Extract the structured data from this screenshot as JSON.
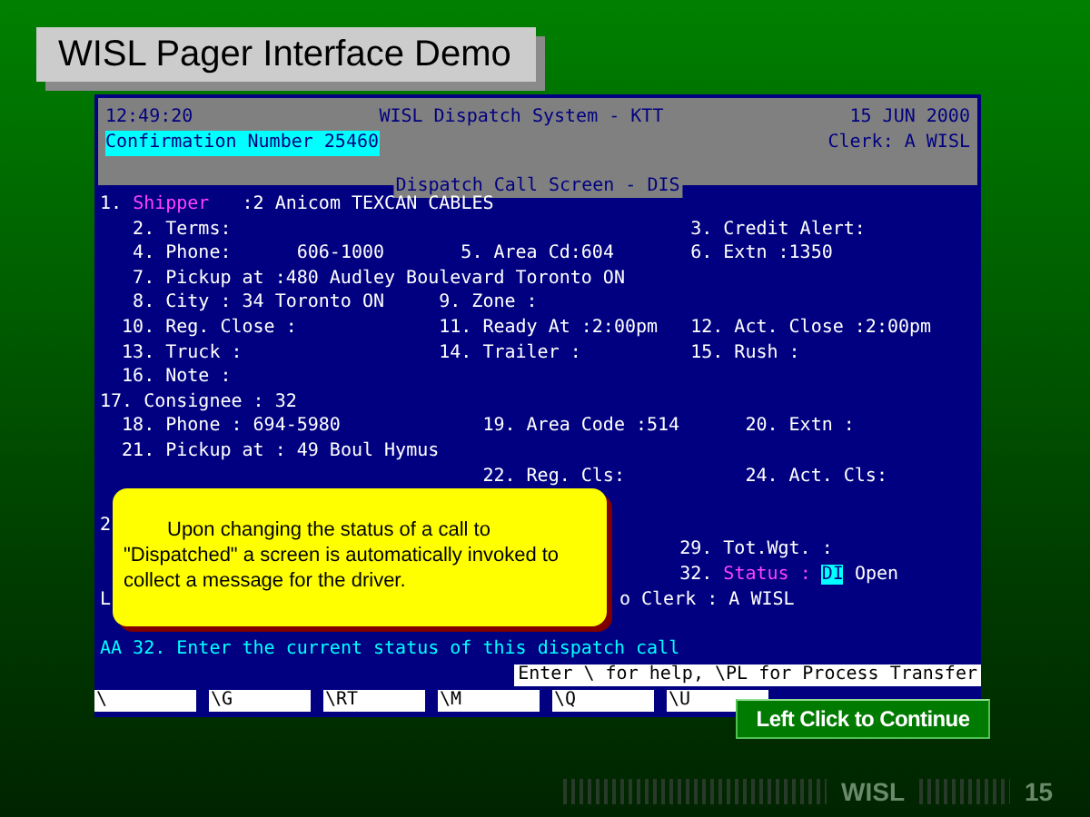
{
  "slide": {
    "title": "WISL Pager Interface Demo"
  },
  "terminal": {
    "header": {
      "time": "12:49:20",
      "system": "WISL Dispatch System - KTT",
      "date": "15 JUN 2000",
      "confirmation": "Confirmation Number 25460",
      "clerk": "Clerk: A WISL",
      "screen": "Dispatch Call Screen - DIS"
    },
    "rows": [
      [
        {
          "kind": "active",
          "num": "1.",
          "label": "Shipper",
          "value": ":2 Anicom TEXCAN CABLES"
        }
      ],
      [
        {
          "kind": "plain",
          "text": "2. Terms:"
        },
        {
          "kind": "plain",
          "text": "3. Credit Alert:"
        }
      ],
      [
        {
          "kind": "plain",
          "text": "4. Phone:"
        },
        {
          "kind": "plain",
          "text": "606-1000"
        },
        {
          "kind": "plain",
          "text": "5. Area Cd:604"
        },
        {
          "kind": "plain",
          "text": "6. Extn :1350"
        }
      ],
      [
        {
          "kind": "plain",
          "text": "7. Pickup at :480 Audley Boulevard Toronto ON"
        }
      ],
      [
        {
          "kind": "plain",
          "text": "8. City : 34 Toronto ON"
        },
        {
          "kind": "plain",
          "text": "9. Zone :"
        }
      ],
      [
        {
          "kind": "plain",
          "text": "10. Reg. Close :"
        },
        {
          "kind": "plain",
          "text": "11. Ready At :2:00pm"
        },
        {
          "kind": "plain",
          "text": "12. Act. Close :2:00pm"
        }
      ],
      [
        {
          "kind": "plain",
          "text": "13. Truck :"
        },
        {
          "kind": "plain",
          "text": "14. Trailer :"
        },
        {
          "kind": "plain",
          "text": "15. Rush :"
        }
      ],
      [
        {
          "kind": "plain",
          "text": "16. Note :"
        }
      ],
      [
        {
          "kind": "plain",
          "text": "17. Consignee : 32"
        }
      ],
      [
        {
          "kind": "plain",
          "text": "18. Phone : 694-5980"
        },
        {
          "kind": "plain",
          "text": "19. Area Code :514"
        },
        {
          "kind": "plain",
          "text": "20. Extn :"
        }
      ],
      [
        {
          "kind": "plain",
          "text": "21. Pickup at : 49 Boul Hymus"
        }
      ],
      [
        {
          "kind": "plain",
          "text": "22. Reg. Cls:"
        },
        {
          "kind": "plain",
          "text": "24. Act. Cls:"
        }
      ],
      [
        {
          "kind": "plain",
          "text": "2"
        }
      ],
      [
        {
          "kind": "plain",
          "text": "29. Tot.Wgt. :"
        }
      ],
      [
        {
          "kind": "cursor",
          "num": "32.",
          "label": "Status :",
          "input": "DI",
          "value": "Open"
        }
      ],
      [
        {
          "kind": "plain",
          "text": "L"
        },
        {
          "kind": "plain",
          "text": "o Clerk : A WISL"
        }
      ]
    ],
    "message": "AA 32. Enter the current status of this dispatch call",
    "help": "Enter \\ for help, \\PL for Process Transfer",
    "function_keys": [
      "\\",
      "\\G",
      "\\RT",
      "\\M",
      "\\Q",
      "\\U"
    ]
  },
  "callout": {
    "text": "Upon changing the status of a call to \"Dispatched\" a screen is automatically invoked to collect a message for the driver."
  },
  "continue_button": {
    "label": "Left Click to Continue"
  },
  "footer": {
    "brand": "WISL",
    "page": "15"
  }
}
